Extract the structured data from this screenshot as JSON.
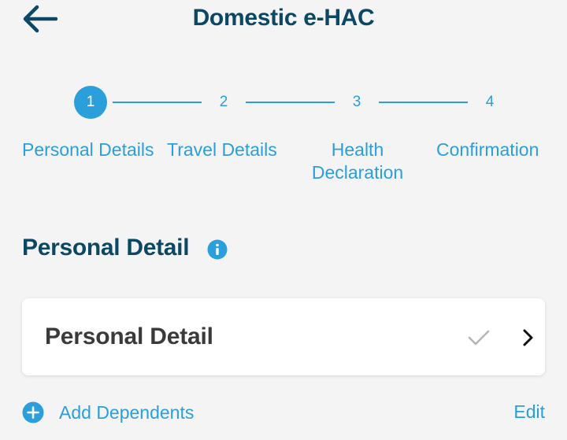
{
  "header": {
    "title": "Domestic e-HAC",
    "back_icon": "arrow-left-icon"
  },
  "stepper": {
    "current_step": 1,
    "steps": [
      {
        "number": "1",
        "label": "Personal Details",
        "state": "active"
      },
      {
        "number": "2",
        "label": "Travel Details",
        "state": "inactive"
      },
      {
        "number": "3",
        "label": "Health\nDeclaration",
        "state": "inactive"
      },
      {
        "number": "4",
        "label": "Confirmation",
        "state": "inactive"
      }
    ]
  },
  "section": {
    "title": "Personal Detail",
    "info_icon": "info-icon"
  },
  "card": {
    "label": "Personal Detail",
    "status_icon": "check-icon",
    "nav_icon": "chevron-right-icon"
  },
  "footer": {
    "add_dependents_label": "Add Dependents",
    "add_icon": "plus-circle-icon",
    "edit_label": "Edit"
  },
  "colors": {
    "brand_dark": "#0c4766",
    "accent": "#2a9fdb",
    "background": "#f4f4f4",
    "check_muted": "#b5b5b5"
  }
}
